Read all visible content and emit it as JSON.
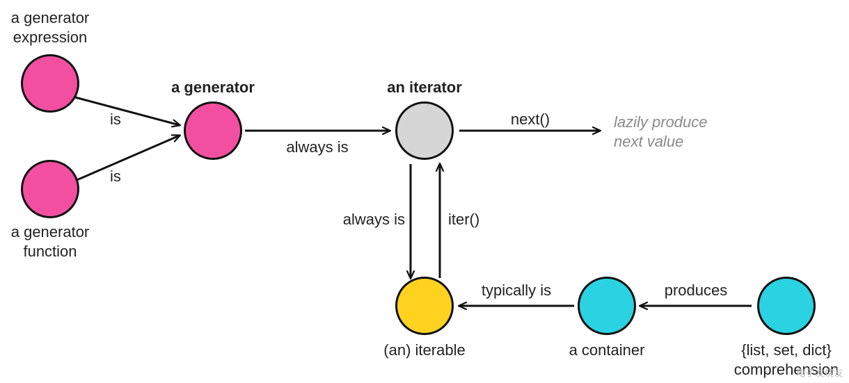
{
  "nodes": {
    "gen_expr": {
      "label": "a generator\nexpression",
      "color": "pink"
    },
    "gen_func": {
      "label": "a generator\nfunction",
      "color": "pink"
    },
    "generator": {
      "label": "a generator",
      "color": "pink",
      "bold": true
    },
    "iterator": {
      "label": "an iterator",
      "color": "grey",
      "bold": true
    },
    "iterable": {
      "label": "(an) iterable",
      "color": "yellow"
    },
    "container": {
      "label": "a container",
      "color": "cyan"
    },
    "comp": {
      "label": "{list, set, dict}\ncomprehension",
      "color": "cyan"
    }
  },
  "edges": {
    "expr_to_gen": {
      "label": "is"
    },
    "func_to_gen": {
      "label": "is"
    },
    "gen_to_iter": {
      "label": "always is"
    },
    "iter_to_itrb": {
      "label": "always is"
    },
    "itrb_to_iter": {
      "label": "iter()"
    },
    "iter_next": {
      "label": "next()"
    },
    "cont_to_itrb": {
      "label": "typically is"
    },
    "comp_to_cont": {
      "label": "produces"
    }
  },
  "notes": {
    "lazy": "lazily produce\nnext value"
  },
  "watermark": "电子发烧友"
}
